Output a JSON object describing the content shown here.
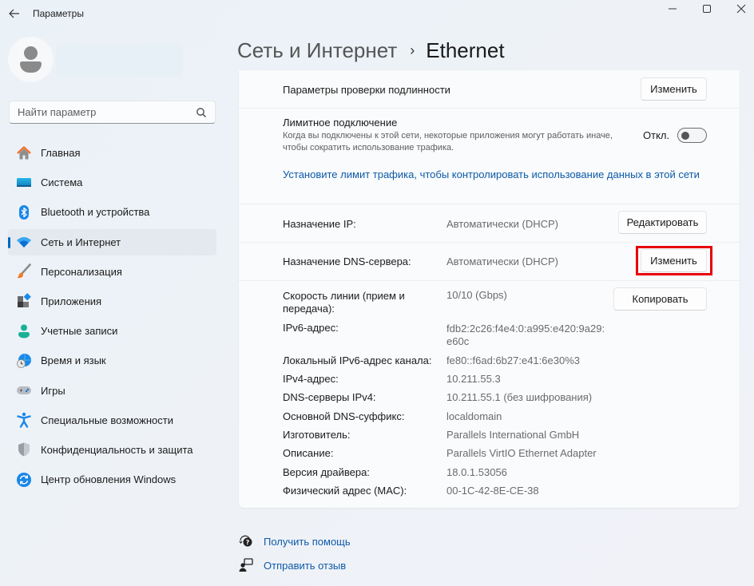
{
  "window": {
    "title": "Параметры",
    "controls": {
      "minimize": "minimize",
      "maximize": "maximize",
      "close": "close"
    }
  },
  "search": {
    "placeholder": "Найти параметр",
    "value": ""
  },
  "sidebar": {
    "items": [
      {
        "label": "Главная",
        "icon": "home-icon"
      },
      {
        "label": "Система",
        "icon": "system-icon"
      },
      {
        "label": "Bluetooth и устройства",
        "icon": "bluetooth-icon"
      },
      {
        "label": "Сеть и Интернет",
        "icon": "wifi-icon",
        "active": true
      },
      {
        "label": "Персонализация",
        "icon": "brush-icon"
      },
      {
        "label": "Приложения",
        "icon": "apps-icon"
      },
      {
        "label": "Учетные записи",
        "icon": "account-icon"
      },
      {
        "label": "Время и язык",
        "icon": "time-language-icon"
      },
      {
        "label": "Игры",
        "icon": "gamepad-icon"
      },
      {
        "label": "Специальные возможности",
        "icon": "accessibility-icon"
      },
      {
        "label": "Конфиденциальность и защита",
        "icon": "shield-icon"
      },
      {
        "label": "Центр обновления Windows",
        "icon": "update-icon"
      }
    ]
  },
  "header": {
    "parent": "Сеть и Интернет",
    "separator": "›",
    "current": "Ethernet"
  },
  "card": {
    "auth": {
      "label": "Параметры проверки подлинности",
      "button": "Изменить"
    },
    "metered": {
      "label": "Лимитное подключение",
      "description_line1": "Когда вы подключены к этой сети, некоторые приложения могут работать иначе,",
      "description_line2": "чтобы сократить использование трафика.",
      "toggle_state": "Откл.",
      "toggle_on": false,
      "link": "Установите лимит трафика, чтобы контролировать использование данных в этой сети"
    },
    "ip_assignment": {
      "label": "Назначение IP:",
      "value": "Автоматически (DHCP)",
      "button": "Редактировать"
    },
    "dns_assignment": {
      "label": "Назначение DNS-сервера:",
      "value": "Автоматически (DHCP)",
      "button": "Изменить"
    },
    "copy_button": "Копировать",
    "properties": [
      {
        "label_line1": "Скорость линии (прием и",
        "label_line2": "передача):",
        "value": "10/10 (Gbps)"
      },
      {
        "label": "IPv6-адрес:",
        "value_line1": "fdb2:2c26:f4e4:0:a995:e420:9a29:",
        "value_line2": "e60c"
      },
      {
        "label": "Локальный IPv6-адрес канала:",
        "value": "fe80::f6ad:6b27:e41:6e30%3"
      },
      {
        "label": "IPv4-адрес:",
        "value": "10.211.55.3"
      },
      {
        "label": "DNS-серверы IPv4:",
        "value": "10.211.55.1 (без шифрования)"
      },
      {
        "label": "Основной DNS-суффикс:",
        "value": "localdomain"
      },
      {
        "label": "Изготовитель:",
        "value": "Parallels International GmbH"
      },
      {
        "label": "Описание:",
        "value": "Parallels VirtIO Ethernet Adapter"
      },
      {
        "label": "Версия драйвера:",
        "value": "18.0.1.53056"
      },
      {
        "label": "Физический адрес (MAC):",
        "value": "00-1C-42-8E-CE-38"
      }
    ]
  },
  "footer": {
    "help": "Получить помощь",
    "feedback": "Отправить отзыв"
  },
  "colors": {
    "accent": "#0067c0",
    "link": "#0e5aa8",
    "highlight": "#e8000b"
  }
}
